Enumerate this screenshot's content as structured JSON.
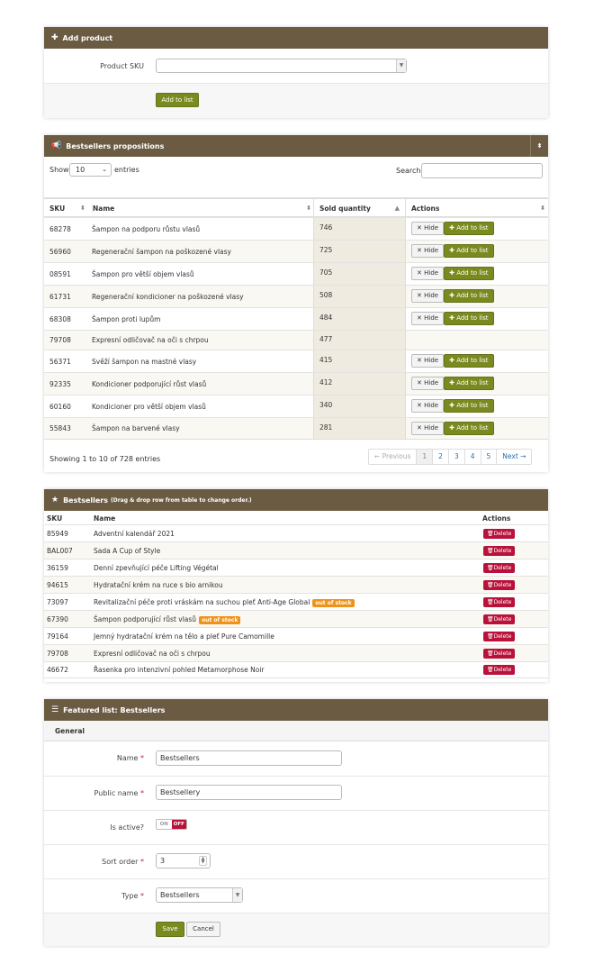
{
  "add_product": {
    "title": "Add product",
    "sku_label": "Product SKU",
    "sku_value": "",
    "add_button": "Add to list"
  },
  "propositions": {
    "title": "Bestsellers propositions",
    "show_label": "Show",
    "show_value": "10",
    "entries_label": "entries",
    "search_label": "Search:",
    "search_value": "",
    "columns": [
      "SKU",
      "Name",
      "Sold quantity",
      "Actions"
    ],
    "hide_label": "Hide",
    "add_label": "Add to list",
    "rows": [
      {
        "sku": "68278",
        "name": "Šampon na podporu růstu vlasů",
        "qty": "746",
        "actions": true
      },
      {
        "sku": "56960",
        "name": "Regenerační šampon na poškozené vlasy",
        "qty": "725",
        "actions": true
      },
      {
        "sku": "08591",
        "name": "Šampon pro větší objem vlasů",
        "qty": "705",
        "actions": true
      },
      {
        "sku": "61731",
        "name": "Regenerační kondicioner na poškozené vlasy",
        "qty": "508",
        "actions": true
      },
      {
        "sku": "68308",
        "name": "Šampon proti lupům",
        "qty": "484",
        "actions": true
      },
      {
        "sku": "79708",
        "name": "Expresní odličovač na oči s chrpou",
        "qty": "477",
        "actions": false
      },
      {
        "sku": "56371",
        "name": "Svěží šampon na mastné vlasy",
        "qty": "415",
        "actions": true
      },
      {
        "sku": "92335",
        "name": "Kondicioner podporující růst vlasů",
        "qty": "412",
        "actions": true
      },
      {
        "sku": "60160",
        "name": "Kondicioner pro větší objem vlasů",
        "qty": "340",
        "actions": true
      },
      {
        "sku": "55843",
        "name": "Šampon na barvené vlasy",
        "qty": "281",
        "actions": true
      }
    ],
    "showing": "Showing 1 to 10 of 728 entries",
    "pager": {
      "prev": "← Previous",
      "pages": [
        "1",
        "2",
        "3",
        "4",
        "5"
      ],
      "next": "Next →"
    }
  },
  "bestsellers": {
    "title": "Bestsellers",
    "subtitle": "(Drag & drop row from table to change order.)",
    "columns": [
      "SKU",
      "Name",
      "Actions"
    ],
    "delete_label": "Delete",
    "oos_label": "out of stock",
    "rows": [
      {
        "sku": "85949",
        "name": "Adventní kalendář 2021",
        "oos": false
      },
      {
        "sku": "BAL007",
        "name": "Sada A Cup of Style",
        "oos": false
      },
      {
        "sku": "36159",
        "name": "Denní zpevňující péče Lifting Végétal",
        "oos": false
      },
      {
        "sku": "94615",
        "name": "Hydratační krém na ruce s bio arnikou",
        "oos": false
      },
      {
        "sku": "73097",
        "name": "Revitalizační péče proti vráskám na suchou pleť Anti-Age Global",
        "oos": true
      },
      {
        "sku": "67390",
        "name": "Šampon podporující růst vlasů",
        "oos": true
      },
      {
        "sku": "79164",
        "name": "Jemný hydratační krém na tělo a pleť Pure Camomille",
        "oos": false
      },
      {
        "sku": "79708",
        "name": "Expresní odličovač na oči s chrpou",
        "oos": false
      },
      {
        "sku": "46672",
        "name": "Řasenka pro intenzivní pohled Metamorphose Noir",
        "oos": false
      }
    ]
  },
  "featured": {
    "title": "Featured list: Bestsellers",
    "section": "General",
    "name_label": "Name",
    "name_value": "Bestsellers",
    "public_label": "Public name",
    "public_value": "Bestsellery",
    "active_label": "Is active?",
    "active_on": "ON",
    "active_off": "OFF",
    "sort_label": "Sort order",
    "sort_value": "3",
    "type_label": "Type",
    "type_value": "Bestsellers",
    "save": "Save",
    "cancel": "Cancel"
  },
  "colors": {
    "header": "#6b5b42",
    "green": "#7a8a1f",
    "delete": "#b8123a",
    "oos": "#f0911a"
  }
}
